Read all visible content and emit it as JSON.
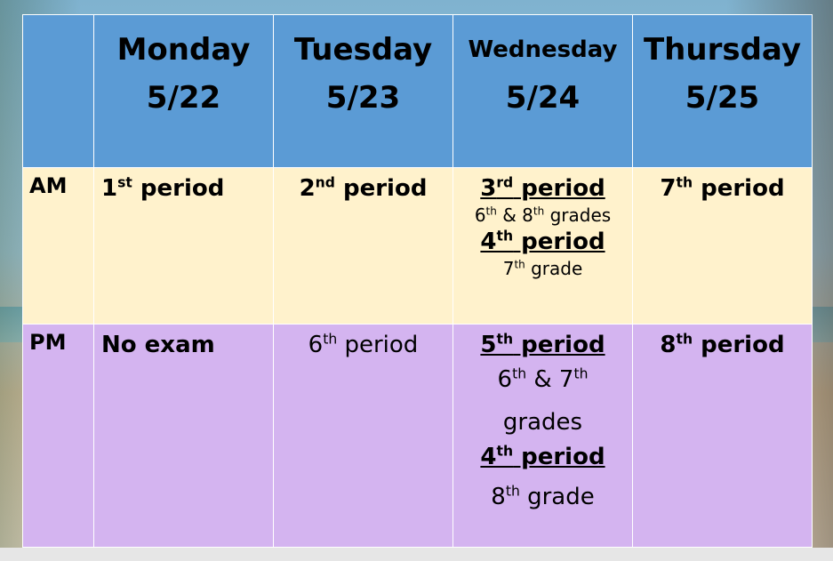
{
  "days": [
    {
      "name": "Monday",
      "date": "5/22"
    },
    {
      "name": "Tuesday",
      "date": "5/23"
    },
    {
      "name": "Wednesday",
      "date": "5/24"
    },
    {
      "name": "Thursday",
      "date": "5/25"
    }
  ],
  "rows": {
    "am": {
      "label": "AM",
      "monday": {
        "num": "1",
        "sup": "st",
        "text": " period"
      },
      "tuesday": {
        "num": "2",
        "sup": "nd",
        "text": " period"
      },
      "wednesday": {
        "first": {
          "num": "3",
          "sup": "rd",
          "text": " period"
        },
        "first_note": {
          "a": "6",
          "a_sup": "th",
          "mid": " & 8",
          "b_sup": "th",
          "end": " grades"
        },
        "second": {
          "num": "4",
          "sup": "th",
          "text": " period"
        },
        "second_note": {
          "a": "7",
          "a_sup": "th",
          "end": " grade"
        }
      },
      "thursday": {
        "num": "7",
        "sup": "th",
        "text": " period"
      }
    },
    "pm": {
      "label": "PM",
      "monday": "No exam",
      "tuesday": {
        "num": "6",
        "sup": "th",
        "text": " period"
      },
      "wednesday": {
        "first": {
          "num": "5",
          "sup": "th",
          "text": " period"
        },
        "first_note": {
          "a": "6",
          "a_sup": "th",
          "mid": " & 7",
          "b_sup": "th",
          "end": "grades"
        },
        "second": {
          "num": "4",
          "sup": "th",
          "text": " period"
        },
        "second_note": {
          "a": "8",
          "a_sup": "th",
          "end": " grade"
        }
      },
      "thursday": {
        "num": "8",
        "sup": "th",
        "text": " period"
      }
    }
  },
  "colors": {
    "header": "#5b9bd5",
    "am": "#fff2cc",
    "pm": "#d4b4f0"
  }
}
